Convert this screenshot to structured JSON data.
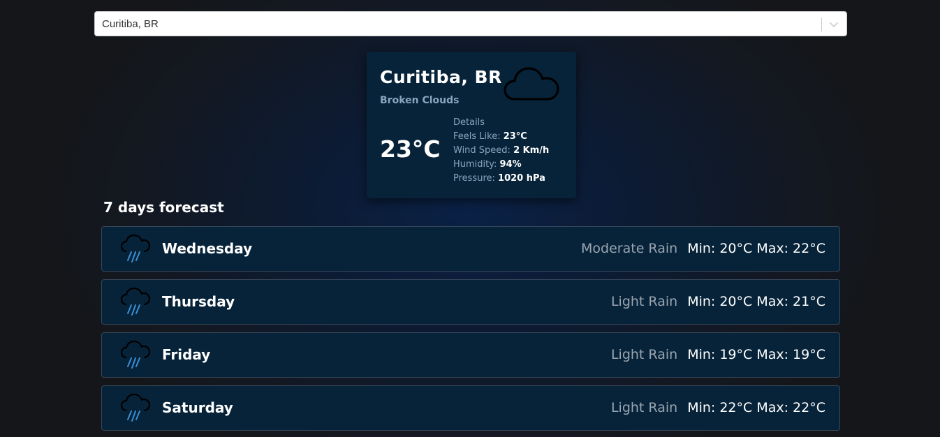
{
  "search": {
    "value": "Curitiba, BR"
  },
  "current": {
    "city": "Curitiba, BR",
    "description": "Broken Clouds",
    "temperature": "23°C",
    "icon": "cloud-icon",
    "details": {
      "heading": "Details",
      "feels_like_label": "Feels Like:",
      "feels_like_value": "23°C",
      "wind_label": "Wind Speed:",
      "wind_value": "2 Km/h",
      "humidity_label": "Humidity:",
      "humidity_value": "94%",
      "pressure_label": "Pressure:",
      "pressure_value": "1020 hPa"
    }
  },
  "forecast": {
    "heading": "7 days forecast",
    "days": [
      {
        "day": "Wednesday",
        "description": "Moderate Rain",
        "minmax": "Min: 20°C Max: 22°C",
        "icon": "rain-cloud-icon"
      },
      {
        "day": "Thursday",
        "description": "Light Rain",
        "minmax": "Min: 20°C Max: 21°C",
        "icon": "rain-cloud-icon"
      },
      {
        "day": "Friday",
        "description": "Light Rain",
        "minmax": "Min: 19°C Max: 19°C",
        "icon": "rain-cloud-icon"
      },
      {
        "day": "Saturday",
        "description": "Light Rain",
        "minmax": "Min: 22°C Max: 22°C",
        "icon": "rain-cloud-icon"
      }
    ]
  },
  "colors": {
    "card_bg": "#072339",
    "muted_text": "#8aa3bf",
    "rain_accent": "#3b8fd6"
  }
}
